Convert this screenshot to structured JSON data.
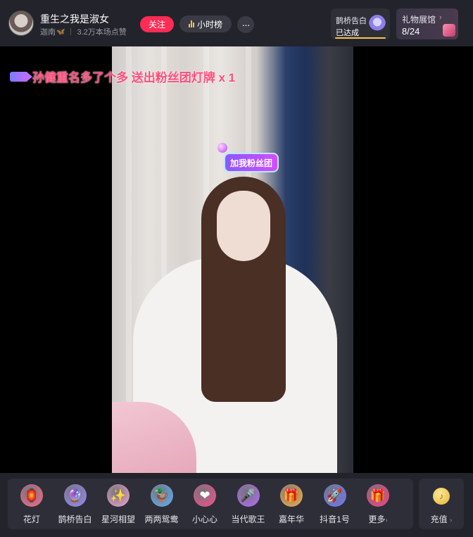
{
  "header": {
    "streamer_name": "重生之我是淑女",
    "location": "迦南",
    "likes_text": "3.2万本场点赞",
    "follow_label": "关注",
    "rank_label": "小时榜",
    "more_label": "···",
    "confession": {
      "title": "鹊桥告白",
      "status": "已达成"
    },
    "gift_gallery": {
      "title": "礼物展馆",
      "count": "8/24",
      "chevron": "›"
    }
  },
  "video": {
    "notice_text": "孙健重名多了个多 送出粉丝团灯牌 x 1",
    "fan_tag_label": "加我粉丝团"
  },
  "gift_bar": {
    "gifts": [
      {
        "label": "花灯",
        "icon": "lantern-icon",
        "color": "#ff6b8a"
      },
      {
        "label": "鹊桥告白",
        "icon": "crystal-ball-icon",
        "color": "#9a8cff"
      },
      {
        "label": "星河相望",
        "icon": "starry-river-icon",
        "color": "#f2a6d8"
      },
      {
        "label": "两两鸳鸯",
        "icon": "mandarin-duck-icon",
        "color": "#5fb3ff"
      },
      {
        "label": "小心心",
        "icon": "heart-icon",
        "color": "#ff4d8d"
      },
      {
        "label": "当代歌王",
        "icon": "singer-icon",
        "color": "#b66cff"
      },
      {
        "label": "嘉年华",
        "icon": "carnival-icon",
        "color": "#ffb347"
      },
      {
        "label": "抖音1号",
        "icon": "rocket-icon",
        "color": "#6f7bff"
      },
      {
        "label": "更多",
        "icon": "gift-box-icon",
        "color": "#ff3b8a"
      }
    ],
    "more_chevron": "›",
    "recharge_label": "充值",
    "recharge_chevron": "›"
  }
}
